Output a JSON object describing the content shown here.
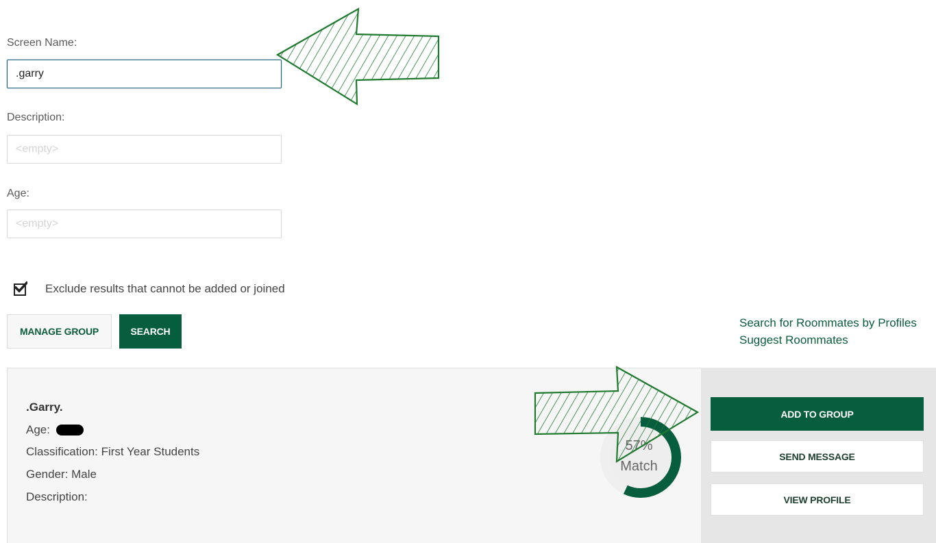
{
  "form": {
    "screen_name_label": "Screen Name:",
    "screen_name_value": ".garry",
    "description_label": "Description:",
    "description_placeholder": "<empty>",
    "age_label": "Age:",
    "age_placeholder": "<empty>",
    "exclude_checkbox_label": "Exclude results that cannot be added or joined",
    "exclude_checked": true,
    "manage_group_label": "MANAGE GROUP",
    "search_label": "SEARCH"
  },
  "side_links": {
    "search_by_profiles": "Search for Roommates by Profiles",
    "suggest_roommates": "Suggest Roommates"
  },
  "result": {
    "name": ".Garry.",
    "age_label": "Age:",
    "classification": "Classification: First Year Students",
    "gender": "Gender: Male",
    "description": "Description:",
    "match_percent_text": "57%",
    "match_percent": 57,
    "match_label": "Match",
    "add_to_group_label": "ADD TO GROUP",
    "send_message_label": "SEND MESSAGE",
    "view_profile_label": "VIEW PROFILE"
  },
  "colors": {
    "brand_green": "#075e3e",
    "focus_border": "#1d5f73",
    "annotation_arrow": "#1f7a30"
  },
  "icons": {
    "checkbox": "checkmark-icon",
    "annotation_left": "arrow-left-icon",
    "annotation_right": "arrow-right-icon"
  }
}
